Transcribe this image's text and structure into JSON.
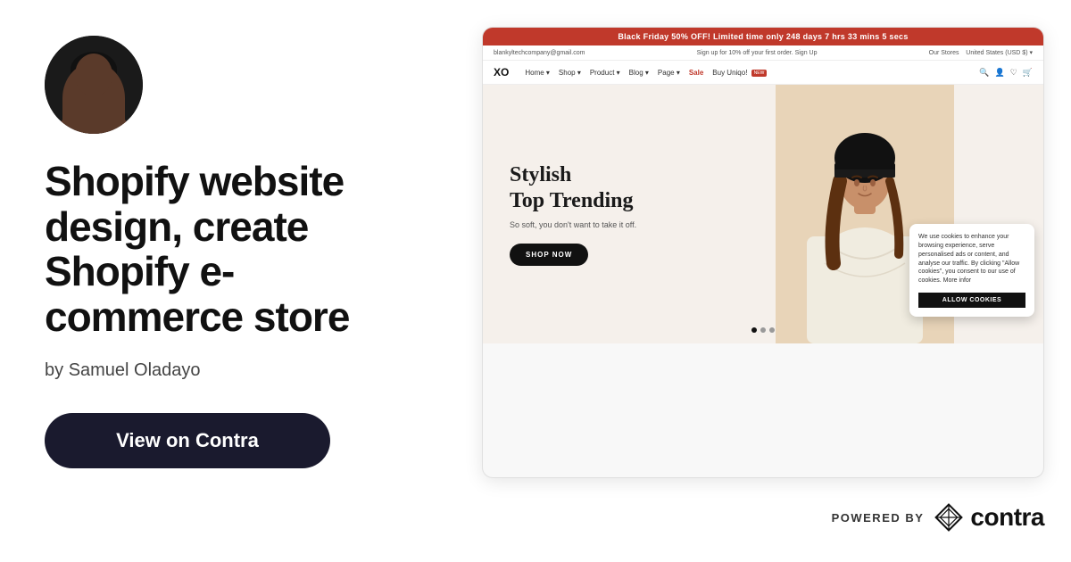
{
  "left": {
    "project_title": "Shopify website design, create Shopify e-commerce store",
    "author_prefix": "by",
    "author_name": "Samuel Oladayo",
    "view_button_label": "View on Contra"
  },
  "right": {
    "store_preview": {
      "bf_banner": "Black Friday 50% OFF! Limited time only   248 days  7 hrs  33 mins  5 secs",
      "info_bar": {
        "left": "blankyltechcompany@gmail.com",
        "center": "Sign up for 10% off your first order. Sign Up",
        "right_store": "Our Stores",
        "right_currency": "United States (USD $) ▾"
      },
      "nav": {
        "logo": "XO",
        "links": [
          "Home ▾",
          "Shop ▾",
          "Product ▾",
          "Blog ▾",
          "Page ▾",
          "Sale",
          "Buy Uniqo!"
        ],
        "new_badge": "NEW"
      },
      "hero": {
        "title_line1": "Stylish",
        "title_line2": "Top Trending",
        "subtitle": "So soft, you don't want to take it off.",
        "cta": "SHOP NOW"
      },
      "cookie": {
        "text": "We use cookies to enhance your browsing experience, serve personalised ads or content, and analyse our traffic. By clicking \"Allow cookies\", you consent to our use of cookies. More infor",
        "button": "ALLOW COOKIES"
      },
      "dots": [
        true,
        false,
        false
      ]
    },
    "powered_by": {
      "text": "POWERED BY",
      "brand": "contra"
    }
  },
  "colors": {
    "bg": "#ffffff",
    "accent_red": "#c0392b",
    "dark": "#1a1a2e",
    "text_dark": "#111111",
    "text_medium": "#444444"
  }
}
